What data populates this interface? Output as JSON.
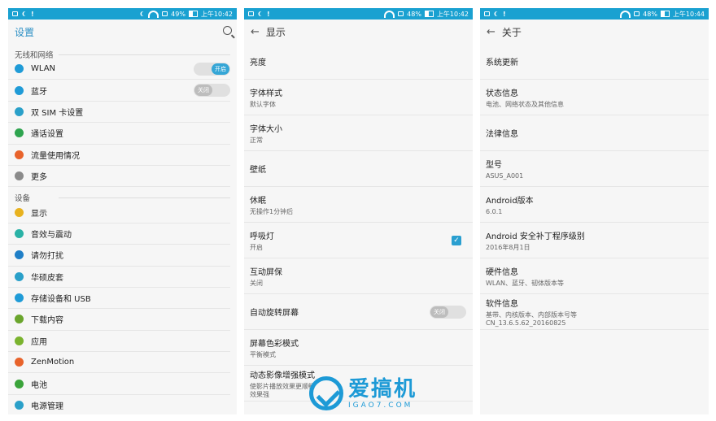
{
  "panel1": {
    "status": {
      "battery": "49%",
      "time": "上午10:42"
    },
    "title": "设置",
    "section1": "无线和网络",
    "items1": [
      {
        "label": "WLAN",
        "icon": "wifi-icon",
        "color": "#1f9bd7",
        "toggle": "开启",
        "on": true
      },
      {
        "label": "蓝牙",
        "icon": "bluetooth-icon",
        "color": "#1f9bd7",
        "toggle": "关闭",
        "on": false
      },
      {
        "label": "双 SIM 卡设置",
        "icon": "sim-icon",
        "color": "#2aa0c9"
      },
      {
        "label": "通话设置",
        "icon": "phone-icon",
        "color": "#2ea44f"
      },
      {
        "label": "流量使用情况",
        "icon": "data-usage-icon",
        "color": "#e8632b"
      },
      {
        "label": "更多",
        "icon": "more-icon",
        "color": "#8a8a8a"
      }
    ],
    "section2": "设备",
    "items2": [
      {
        "label": "显示",
        "icon": "display-icon",
        "color": "#e8b21f"
      },
      {
        "label": "音效与震动",
        "icon": "sound-icon",
        "color": "#2ab2a6"
      },
      {
        "label": "请勿打扰",
        "icon": "moon-icon",
        "color": "#1f7fc7"
      },
      {
        "label": "华硕皮套",
        "icon": "cover-icon",
        "color": "#2aa0c9"
      },
      {
        "label": "存储设备和 USB",
        "icon": "storage-icon",
        "color": "#1f9bd7"
      },
      {
        "label": "下载内容",
        "icon": "download-icon",
        "color": "#6aa52c"
      },
      {
        "label": "应用",
        "icon": "apps-icon",
        "color": "#7ab32e"
      },
      {
        "label": "ZenMotion",
        "icon": "zenmotion-icon",
        "color": "#e8632b"
      },
      {
        "label": "电池",
        "icon": "battery-icon",
        "color": "#3aa33a"
      },
      {
        "label": "电源管理",
        "icon": "power-icon",
        "color": "#2aa0c9"
      }
    ]
  },
  "panel2": {
    "status": {
      "battery": "48%",
      "time": "上午10:42"
    },
    "title": "显示",
    "items": [
      {
        "title": "亮度",
        "sub": ""
      },
      {
        "title": "字体样式",
        "sub": "默认字体"
      },
      {
        "title": "字体大小",
        "sub": "正常"
      },
      {
        "title": "壁纸",
        "sub": ""
      },
      {
        "title": "休眠",
        "sub": "无操作1分钟后"
      },
      {
        "title": "呼吸灯",
        "sub": "开启",
        "checkbox": true
      },
      {
        "title": "互动屏保",
        "sub": "关闭"
      },
      {
        "title": "自动旋转屏幕",
        "sub": "",
        "toggle": "关闭"
      },
      {
        "title": "屏幕色彩模式",
        "sub": "平衡模式"
      },
      {
        "title": "动态影像增强模式",
        "sub": "使影片播放效果更顺畅",
        "sub2": "效果强"
      }
    ]
  },
  "panel3": {
    "status": {
      "battery": "48%",
      "time": "上午10:44"
    },
    "title": "关于",
    "items": [
      {
        "title": "系统更新",
        "sub": ""
      },
      {
        "title": "状态信息",
        "sub": "电池、网络状态及其他信息"
      },
      {
        "title": "法律信息",
        "sub": ""
      },
      {
        "title": "型号",
        "sub": "ASUS_A001"
      },
      {
        "title": "Android版本",
        "sub": "6.0.1"
      },
      {
        "title": "Android 安全补丁程序级别",
        "sub": "2016年8月1日"
      },
      {
        "title": "硬件信息",
        "sub": "WLAN、蓝牙、韧体版本等"
      },
      {
        "title": "软件信息",
        "sub": "基带、内核版本、内部版本号等",
        "sub2": "CN_13.6.5.62_20160825"
      }
    ]
  },
  "watermark": {
    "cn": "爱搞机",
    "en": "IGAO7.COM"
  }
}
